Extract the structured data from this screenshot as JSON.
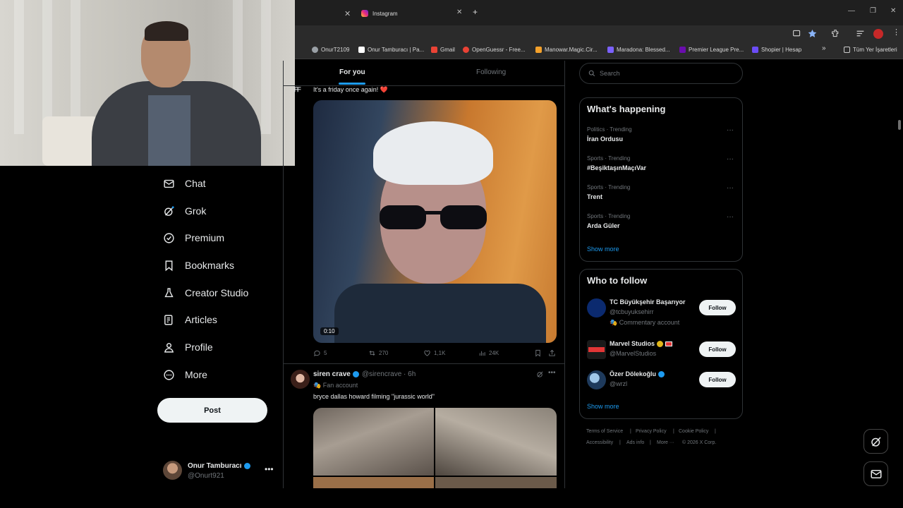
{
  "browser": {
    "tab_left_label": "",
    "tab_active_label": "Instagram",
    "new_tab": "+",
    "bookmarks": [
      {
        "label": "OnurT2109",
        "color": "#9aa0a6"
      },
      {
        "label": "Onur Tamburacı | Pa...",
        "color": "#ffffff"
      },
      {
        "label": "Gmail",
        "color": "#ea4335"
      },
      {
        "label": "OpenGuessr - Free...",
        "color": "#e94235"
      },
      {
        "label": "Manowar.Magic.Cir...",
        "color": "#f4a12b"
      },
      {
        "label": "Maradona: Blessed...",
        "color": "#7b61ff"
      },
      {
        "label": "Premier League Pre...",
        "color": "#6a0dad"
      },
      {
        "label": "Shopier | Hesap",
        "color": "#6b4cf6"
      },
      {
        "label": "Tüm Yer İşaretleri",
        "color": "#cccccc"
      }
    ],
    "bookmark_overflow": "»"
  },
  "nav": {
    "items": [
      {
        "label": "Chat",
        "icon": "mail-icon"
      },
      {
        "label": "Grok",
        "icon": "grok-icon"
      },
      {
        "label": "Premium",
        "icon": "premium-icon"
      },
      {
        "label": "Bookmarks",
        "icon": "bookmark-icon"
      },
      {
        "label": "Creator Studio",
        "icon": "creator-studio-icon"
      },
      {
        "label": "Articles",
        "icon": "articles-icon"
      },
      {
        "label": "Profile",
        "icon": "profile-icon"
      },
      {
        "label": "More",
        "icon": "more-circle-icon"
      }
    ],
    "post_label": "Post",
    "account": {
      "name": "Onur Tamburacı",
      "handle": "@Onurt921",
      "more": "•••"
    }
  },
  "feed": {
    "tabs": [
      "For you",
      "Following"
    ],
    "active_tab": "For you",
    "tweet1": {
      "text": "It's a friday once again! ❤️",
      "video_time": "0:10",
      "replies": "5",
      "reposts": "270",
      "likes": "1,1K",
      "views": "24K"
    },
    "tweet2": {
      "name": "siren crave",
      "handle": "@sirencrave · 6h",
      "badge": "Fan account",
      "text": "bryce dallas howard filming \"jurassic world\""
    }
  },
  "sidebar": {
    "search_placeholder": "Search",
    "whats_happening": {
      "title": "What's happening",
      "trends": [
        {
          "meta": "Politics · Trending",
          "name": "İran Ordusu"
        },
        {
          "meta": "Sports · Trending",
          "name": "#BeşiktaşınMaçıVar"
        },
        {
          "meta": "Sports · Trending",
          "name": "Trent"
        },
        {
          "meta": "Sports · Trending",
          "name": "Arda Güler"
        }
      ],
      "show_more": "Show more"
    },
    "who_to_follow": {
      "title": "Who to follow",
      "accounts": [
        {
          "name": "TC Büyükşehir Başarıyor",
          "handle": "@tcbuyuksehirr",
          "extra": "Commentary account",
          "button": "Follow"
        },
        {
          "name": "Marvel Studios",
          "handle": "@MarvelStudios",
          "extra": "",
          "button": "Follow"
        },
        {
          "name": "Özer Dölekoğlu",
          "handle": "@wrzl",
          "extra": "",
          "button": "Follow"
        }
      ],
      "show_more": "Show more"
    },
    "footer": [
      "Terms of Service",
      "Privacy Policy",
      "Cookie Policy",
      "Accessibility",
      "Ads info",
      "More ···",
      "© 2026 X Corp."
    ]
  },
  "colors": {
    "accent": "#1d9bf0",
    "background": "#000000",
    "like": "#f91880"
  }
}
